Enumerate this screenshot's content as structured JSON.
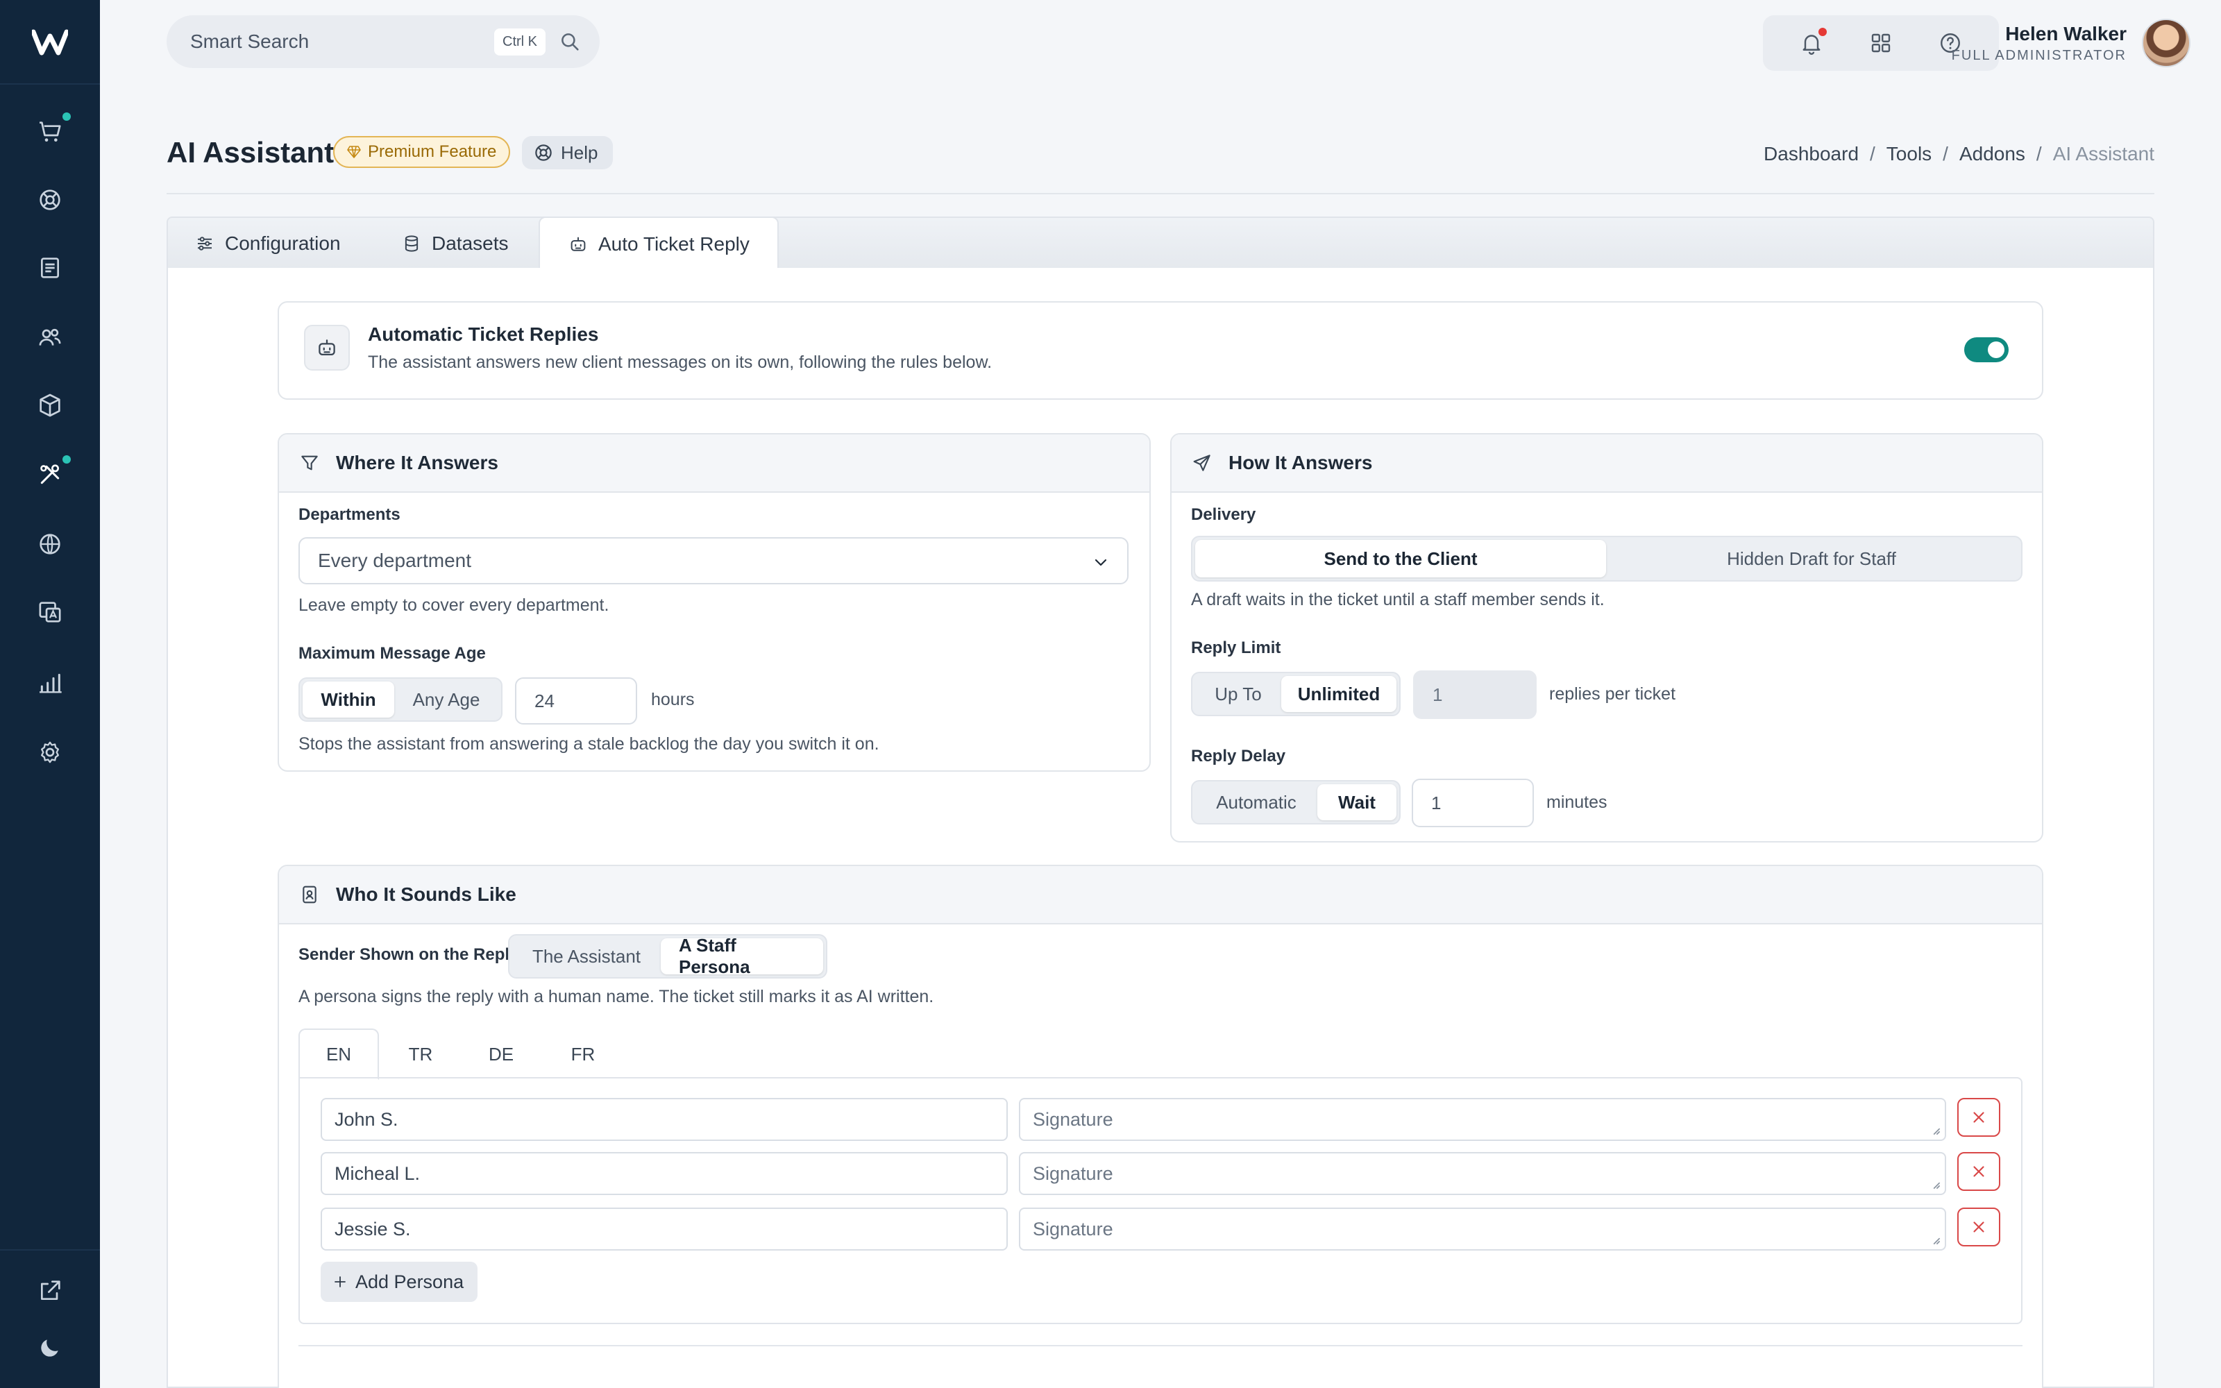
{
  "topbar": {
    "search_placeholder": "Smart Search",
    "search_shortcut": "Ctrl K",
    "user_name": "Helen Walker",
    "user_role": "FULL ADMINISTRATOR"
  },
  "page": {
    "title": "AI Assistant",
    "premium_badge": "Premium Feature",
    "help_label": "Help",
    "breadcrumb": [
      "Dashboard",
      "Tools",
      "Addons",
      "AI Assistant"
    ]
  },
  "tabs": [
    "Configuration",
    "Datasets",
    "Auto Ticket Reply"
  ],
  "auto_replies": {
    "title": "Automatic Ticket Replies",
    "description": "The assistant answers new client messages on its own, following the rules below.",
    "enabled": true
  },
  "where": {
    "title": "Where It Answers",
    "departments_label": "Departments",
    "departments_value": "Every department",
    "departments_hint": "Leave empty to cover every department.",
    "age_label": "Maximum Message Age",
    "age_options": [
      "Within",
      "Any Age"
    ],
    "age_value": "24",
    "age_unit": "hours",
    "age_hint": "Stops the assistant from answering a stale backlog the day you switch it on."
  },
  "how": {
    "title": "How It Answers",
    "delivery_label": "Delivery",
    "delivery_options": [
      "Send to the Client",
      "Hidden Draft for Staff"
    ],
    "delivery_hint": "A draft waits in the ticket until a staff member sends it.",
    "limit_label": "Reply Limit",
    "limit_options": [
      "Up To",
      "Unlimited"
    ],
    "limit_value": "1",
    "limit_unit": "replies per ticket",
    "delay_label": "Reply Delay",
    "delay_options": [
      "Automatic",
      "Wait"
    ],
    "delay_value": "1",
    "delay_unit": "minutes"
  },
  "who": {
    "title": "Who It Sounds Like",
    "sender_label": "Sender Shown on the Reply",
    "sender_options": [
      "The Assistant",
      "A Staff Persona"
    ],
    "sender_hint": "A persona signs the reply with a human name. The ticket still marks it as AI written.",
    "languages": [
      "EN",
      "TR",
      "DE",
      "FR"
    ],
    "personas": [
      {
        "name": "John S.",
        "signature_placeholder": "Signature"
      },
      {
        "name": "Micheal L.",
        "signature_placeholder": "Signature"
      },
      {
        "name": "Jessie S.",
        "signature_placeholder": "Signature"
      }
    ],
    "add_persona": "Add Persona"
  },
  "colors": {
    "sidebar": "#11263c",
    "accent": "#0f8a80",
    "danger": "#d94848",
    "premium": "#e3b555"
  },
  "icons": {
    "sidebar": [
      "cart-icon",
      "support-icon",
      "document-icon",
      "users-icon",
      "package-icon",
      "tools-icon",
      "globe-icon",
      "translate-icon",
      "chart-icon",
      "settings-icon",
      "external-link-icon",
      "moon-icon"
    ]
  }
}
